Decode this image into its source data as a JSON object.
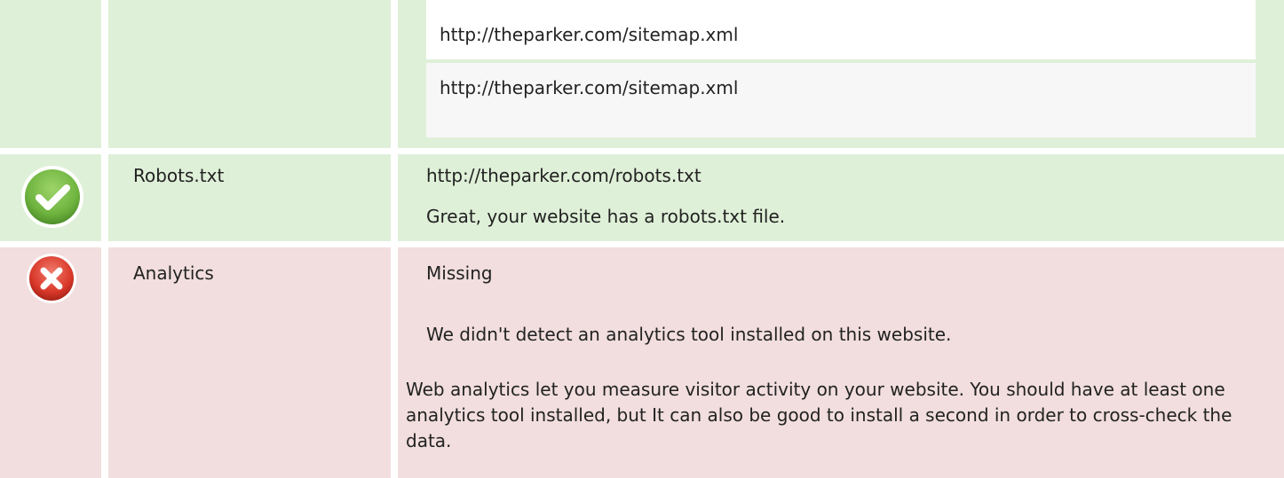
{
  "sitemap": {
    "urls": [
      "http://theparker.com/sitemap.xml",
      "http://theparker.com/sitemap.xml"
    ]
  },
  "robots": {
    "status_icon": "check-icon",
    "status_color": "#5cb85c",
    "label": "Robots.txt",
    "url": "http://theparker.com/robots.txt",
    "message": "Great, your website has a robots.txt file."
  },
  "analytics": {
    "status_icon": "cross-icon",
    "status_color": "#d9534f",
    "label": "Analytics",
    "value": "Missing",
    "message": "We didn't detect an analytics tool installed on this website.",
    "description": "Web analytics let you measure visitor activity on your website. You should have at least one analytics tool installed, but It can also be good to install a second in order to cross-check the data."
  }
}
